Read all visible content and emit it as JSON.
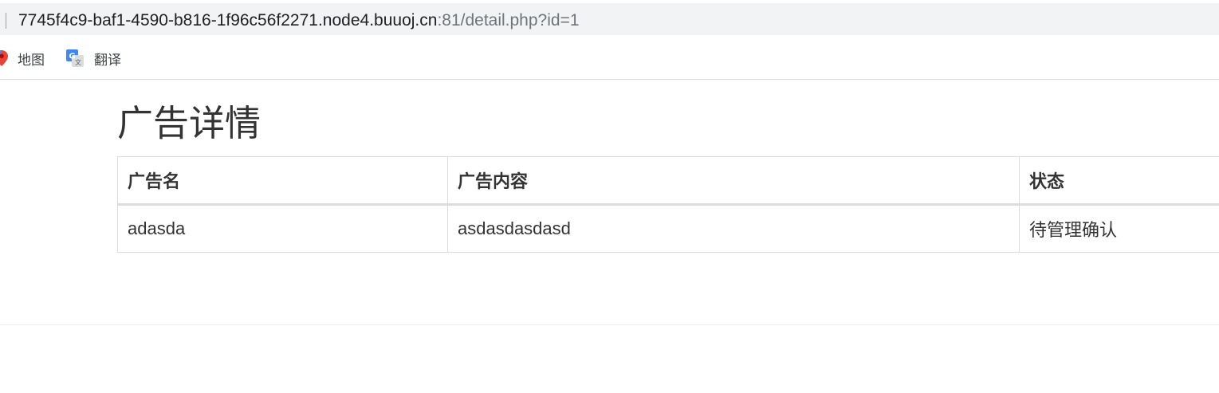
{
  "browser": {
    "url_host": "7745f4c9-baf1-4590-b816-1f96c56f2271.node4.buuoj.cn",
    "url_path": ":81/detail.php?id=1",
    "bookmarks": [
      {
        "label": "地图",
        "icon": "map-pin-icon"
      },
      {
        "label": "翻译",
        "icon": "translate-icon"
      }
    ]
  },
  "page": {
    "title": "广告详情",
    "table": {
      "headers": [
        "广告名",
        "广告内容",
        "状态"
      ],
      "rows": [
        [
          "adasda",
          "asdasdasdasd",
          "待管理确认"
        ]
      ]
    }
  }
}
